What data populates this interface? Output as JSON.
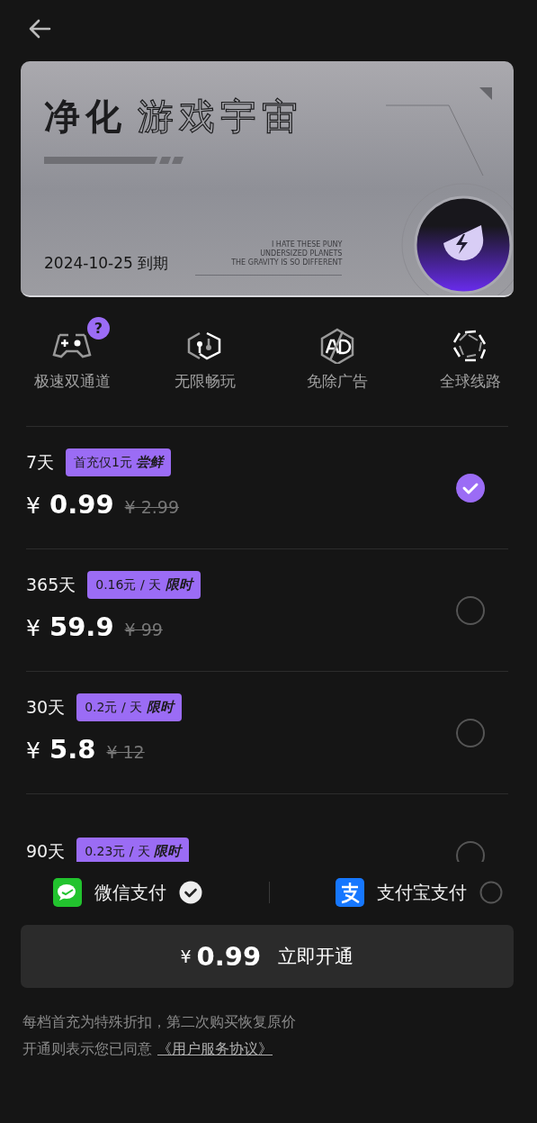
{
  "card": {
    "title_solid": "净化",
    "title_outline": "游戏宇宙",
    "expiry": "2024-10-25 到期",
    "tagline": [
      "I HATE THESE PUNY",
      "UNDERSIZED PLANETS",
      "THE GRAVITY IS SO DIFFERENT"
    ]
  },
  "features": [
    {
      "kind": "gamepad",
      "label": "极速双通道",
      "badge": "?"
    },
    {
      "kind": "link",
      "label": "无限畅玩"
    },
    {
      "kind": "ad",
      "label": "免除广告"
    },
    {
      "kind": "shutter",
      "label": "全球线路"
    }
  ],
  "plans": [
    {
      "duration": "7天",
      "tag": "首充仅1元",
      "tag_emphasis": "尝鲜",
      "currency": "¥",
      "price": "0.99",
      "original_price": "¥ 2.99",
      "selected": true
    },
    {
      "duration": "365天",
      "tag": "0.16元 / 天",
      "tag_emphasis": "限时",
      "currency": "¥",
      "price": "59.9",
      "original_price": "¥ 99",
      "selected": false
    },
    {
      "duration": "30天",
      "tag": "0.2元 / 天",
      "tag_emphasis": "限时",
      "currency": "¥",
      "price": "5.8",
      "original_price": "¥ 12",
      "selected": false
    },
    {
      "duration": "90天",
      "tag": "0.23元 / 天",
      "tag_emphasis": "限时",
      "selected": false
    }
  ],
  "payment": [
    {
      "kind": "wechat",
      "label": "微信支付",
      "selected": true
    },
    {
      "kind": "alipay",
      "label": "支付宝支付",
      "selected": false
    }
  ],
  "buy_button": {
    "currency": "¥",
    "amount": "0.99",
    "label": "立即开通"
  },
  "footer": {
    "note": "每档首充为特殊折扣，第二次购买恢复原价",
    "agreement": "开通则表示您已同意",
    "link": "《用户服务协议》"
  }
}
